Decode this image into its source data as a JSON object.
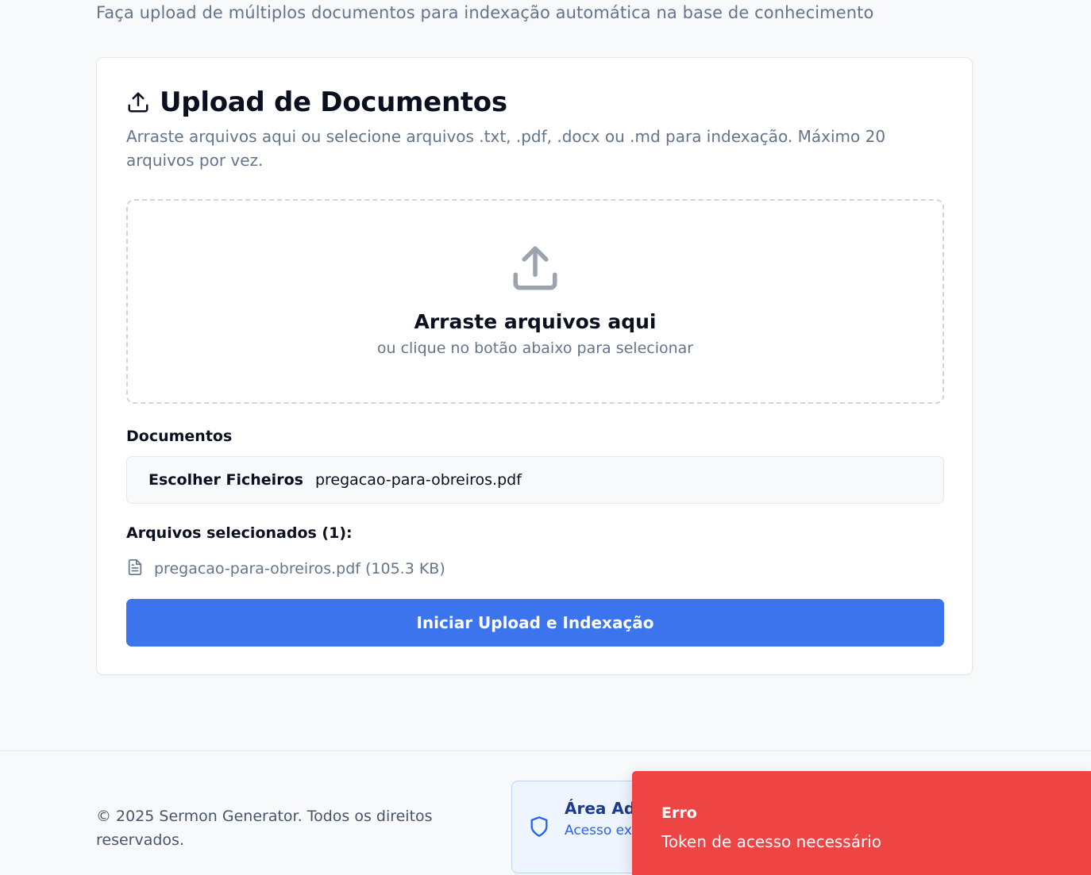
{
  "header": {
    "subtitle": "Faça upload de múltiplos documentos para indexação automática na base de conhecimento"
  },
  "card": {
    "title": "Upload de Documentos",
    "title_icon": "upload-icon",
    "description": "Arraste arquivos aqui ou selecione arquivos .txt, .pdf, .docx ou .md para indexação. Máximo 20 arquivos por vez."
  },
  "dropzone": {
    "icon": "upload-icon",
    "title": "Arraste arquivos aqui",
    "hint": "ou clique no botão abaixo para selecionar"
  },
  "file_input": {
    "label": "Documentos",
    "button_label": "Escolher Ficheiros",
    "value": "pregacao-para-obreiros.pdf"
  },
  "selected_files": {
    "label": "Arquivos selecionados (1):",
    "items": [
      {
        "icon": "file-text-icon",
        "text": "pregacao-para-obreiros.pdf (105.3 KB)"
      }
    ]
  },
  "upload_button": {
    "label": "Iniciar Upload e Indexação",
    "color": "#3b74ec"
  },
  "footer": {
    "copyright": "© 2025 Sermon Generator. Todos os direitos reservados.",
    "admin": {
      "icon": "shield-icon",
      "title": "Área Adm",
      "description": "Acesso exc administra"
    }
  },
  "toast": {
    "type": "error",
    "color": "#ef4444",
    "title": "Erro",
    "message": "Token de acesso necessário"
  }
}
